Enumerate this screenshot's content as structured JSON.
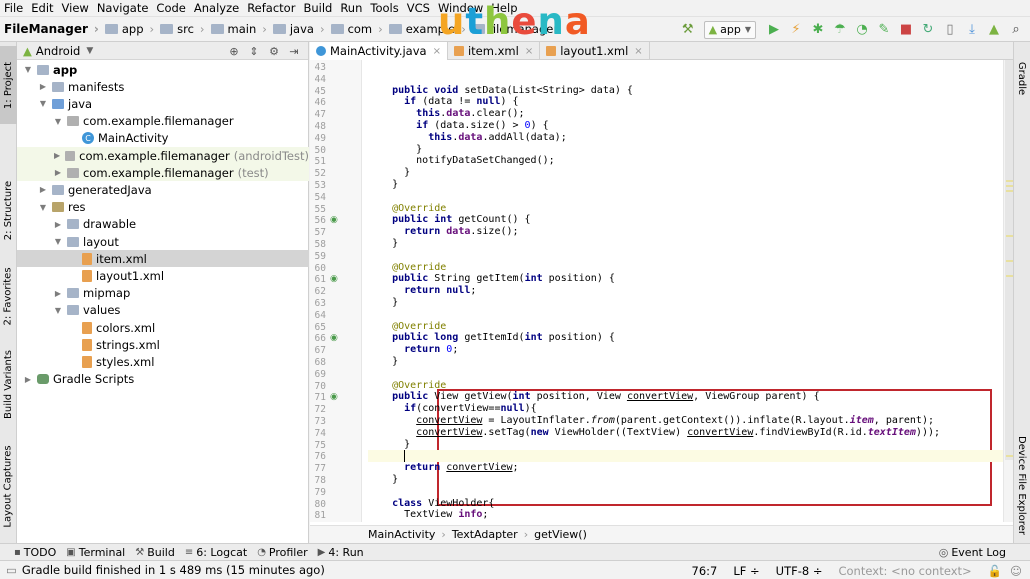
{
  "menu": [
    "File",
    "Edit",
    "View",
    "Navigate",
    "Code",
    "Analyze",
    "Refactor",
    "Build",
    "Run",
    "Tools",
    "VCS",
    "Window",
    "Help"
  ],
  "breadcrumbs": [
    "FileManager",
    "app",
    "src",
    "main",
    "java",
    "com",
    "example",
    "filemanager"
  ],
  "run_config": "app",
  "logo": {
    "letters": [
      "u",
      "t",
      "h",
      "e",
      "n",
      "a"
    ],
    "colors": [
      "#f4a523",
      "#1b9fd6",
      "#8dc63f",
      "#e94b3c",
      "#29b9c5",
      "#f15a24"
    ]
  },
  "left_tool_windows": [
    "1: Project",
    "2: Structure",
    "2: Favorites",
    "Build Variants",
    "Layout Captures"
  ],
  "right_tool_windows": [
    "Gradle",
    "Device File Explorer"
  ],
  "project_panel": {
    "view_label": "Android",
    "tree": [
      {
        "label": "app",
        "depth": 0,
        "arrow": "▼",
        "icon": "dir",
        "bold": true
      },
      {
        "label": "manifests",
        "depth": 1,
        "arrow": "▶",
        "icon": "dir"
      },
      {
        "label": "java",
        "depth": 1,
        "arrow": "▼",
        "icon": "dir-src"
      },
      {
        "label": "com.example.filemanager",
        "depth": 2,
        "arrow": "▼",
        "icon": "pkg"
      },
      {
        "label": "MainActivity",
        "depth": 3,
        "arrow": "",
        "icon": "cls"
      },
      {
        "label": "com.example.filemanager",
        "depth": 2,
        "arrow": "▶",
        "icon": "pkg",
        "suffix": "(androidTest)",
        "test": true
      },
      {
        "label": "com.example.filemanager",
        "depth": 2,
        "arrow": "▶",
        "icon": "pkg",
        "suffix": "(test)",
        "test": true
      },
      {
        "label": "generatedJava",
        "depth": 1,
        "arrow": "▶",
        "icon": "dir"
      },
      {
        "label": "res",
        "depth": 1,
        "arrow": "▼",
        "icon": "dir-res"
      },
      {
        "label": "drawable",
        "depth": 2,
        "arrow": "▶",
        "icon": "dir"
      },
      {
        "label": "layout",
        "depth": 2,
        "arrow": "▼",
        "icon": "dir"
      },
      {
        "label": "item.xml",
        "depth": 3,
        "arrow": "",
        "icon": "xml",
        "selected": true
      },
      {
        "label": "layout1.xml",
        "depth": 3,
        "arrow": "",
        "icon": "xml"
      },
      {
        "label": "mipmap",
        "depth": 2,
        "arrow": "▶",
        "icon": "dir"
      },
      {
        "label": "values",
        "depth": 2,
        "arrow": "▼",
        "icon": "dir"
      },
      {
        "label": "colors.xml",
        "depth": 3,
        "arrow": "",
        "icon": "xml"
      },
      {
        "label": "strings.xml",
        "depth": 3,
        "arrow": "",
        "icon": "xml"
      },
      {
        "label": "styles.xml",
        "depth": 3,
        "arrow": "",
        "icon": "xml"
      },
      {
        "label": "Gradle Scripts",
        "depth": 0,
        "arrow": "▶",
        "icon": "gradle"
      }
    ]
  },
  "editor": {
    "tabs": [
      {
        "label": "MainActivity.java",
        "icon": "c",
        "active": true
      },
      {
        "label": "item.xml",
        "icon": "x"
      },
      {
        "label": "layout1.xml",
        "icon": "x"
      }
    ],
    "first_line": 43,
    "current_line": 76,
    "lines": [
      [],
      [],
      [
        [
          "    ",
          ""
        ],
        [
          "public void ",
          "kw"
        ],
        [
          "setData(List<String> data) {",
          ""
        ]
      ],
      [
        [
          "      ",
          ""
        ],
        [
          "if ",
          "kw"
        ],
        [
          "(data != ",
          ""
        ],
        [
          "null",
          "kw"
        ],
        [
          ") {",
          ""
        ]
      ],
      [
        [
          "        ",
          ""
        ],
        [
          "this",
          "kw"
        ],
        [
          ".",
          ""
        ],
        [
          "data",
          "fd"
        ],
        [
          ".clear();",
          ""
        ]
      ],
      [
        [
          "        ",
          ""
        ],
        [
          "if ",
          "kw"
        ],
        [
          "(data.size() > ",
          ""
        ],
        [
          "0",
          "num"
        ],
        [
          ") {",
          ""
        ]
      ],
      [
        [
          "          ",
          ""
        ],
        [
          "this",
          "kw"
        ],
        [
          ".",
          ""
        ],
        [
          "data",
          "fd"
        ],
        [
          ".addAll(data);",
          ""
        ]
      ],
      [
        [
          "        }",
          ""
        ]
      ],
      [
        [
          "        notifyDataSetChanged();",
          ""
        ]
      ],
      [
        [
          "      }",
          ""
        ]
      ],
      [
        [
          "    }",
          ""
        ]
      ],
      [],
      [
        [
          "    ",
          ""
        ],
        [
          "@Override",
          "an"
        ]
      ],
      [
        [
          "    ",
          ""
        ],
        [
          "public int ",
          "kw"
        ],
        [
          "getCount() {",
          ""
        ]
      ],
      [
        [
          "      ",
          ""
        ],
        [
          "return ",
          "kw"
        ],
        [
          "data",
          "fd"
        ],
        [
          ".size();",
          ""
        ]
      ],
      [
        [
          "    }",
          ""
        ]
      ],
      [],
      [
        [
          "    ",
          ""
        ],
        [
          "@Override",
          "an"
        ]
      ],
      [
        [
          "    ",
          ""
        ],
        [
          "public ",
          "kw"
        ],
        [
          "String getItem(",
          ""
        ],
        [
          "int ",
          "kw"
        ],
        [
          "position) {",
          ""
        ]
      ],
      [
        [
          "      ",
          ""
        ],
        [
          "return null",
          "kw"
        ],
        [
          ";",
          ""
        ]
      ],
      [
        [
          "    }",
          ""
        ]
      ],
      [],
      [
        [
          "    ",
          ""
        ],
        [
          "@Override",
          "an"
        ]
      ],
      [
        [
          "    ",
          ""
        ],
        [
          "public long ",
          "kw"
        ],
        [
          "getItemId(",
          ""
        ],
        [
          "int ",
          "kw"
        ],
        [
          "position) {",
          ""
        ]
      ],
      [
        [
          "      ",
          ""
        ],
        [
          "return ",
          "kw"
        ],
        [
          "0",
          "num"
        ],
        [
          ";",
          ""
        ]
      ],
      [
        [
          "    }",
          ""
        ]
      ],
      [],
      [
        [
          "    ",
          ""
        ],
        [
          "@Override",
          "an"
        ]
      ],
      [
        [
          "    ",
          ""
        ],
        [
          "public ",
          "kw"
        ],
        [
          "View getView(",
          ""
        ],
        [
          "int ",
          "kw"
        ],
        [
          "position, View ",
          ""
        ],
        [
          "convertView",
          "ul"
        ],
        [
          ", ViewGroup parent) {",
          ""
        ]
      ],
      [
        [
          "      ",
          ""
        ],
        [
          "if",
          "kw"
        ],
        [
          "(convertView==",
          ""
        ],
        [
          "null",
          "kw"
        ],
        [
          "){",
          ""
        ]
      ],
      [
        [
          "        ",
          ""
        ],
        [
          "convertView",
          "ul"
        ],
        [
          " = LayoutInflater.",
          ""
        ],
        [
          "from",
          "it"
        ],
        [
          "(parent.getContext()).inflate(R.layout.",
          ""
        ],
        [
          "item",
          "fit"
        ],
        [
          ", parent);",
          ""
        ]
      ],
      [
        [
          "        ",
          ""
        ],
        [
          "convertView",
          "ul"
        ],
        [
          ".setTag(",
          ""
        ],
        [
          "new ",
          "kw"
        ],
        [
          "ViewHolder((TextView) ",
          ""
        ],
        [
          "convertView",
          "ul"
        ],
        [
          ".findViewById(R.id.",
          ""
        ],
        [
          "textItem",
          "fit"
        ],
        [
          ")));",
          ""
        ]
      ],
      [
        [
          "      }",
          ""
        ]
      ],
      [
        [
          "      ",
          ""
        ]
      ],
      [
        [
          "      ",
          ""
        ],
        [
          "return ",
          "kw"
        ],
        [
          "convertView",
          "ul"
        ],
        [
          ";",
          ""
        ]
      ],
      [
        [
          "    }",
          ""
        ]
      ],
      [],
      [
        [
          "    ",
          ""
        ],
        [
          "class ",
          "kw"
        ],
        [
          "ViewHolder{",
          ""
        ]
      ],
      [
        [
          "      TextView ",
          ""
        ],
        [
          "info",
          "fd"
        ],
        [
          ";",
          ""
        ]
      ]
    ],
    "override_lines": [
      56,
      61,
      66,
      71
    ],
    "crumbs": [
      "MainActivity",
      "TextAdapter",
      "getView()"
    ]
  },
  "bottom_tools": [
    {
      "icon": "▪",
      "label": "TODO"
    },
    {
      "icon": "▣",
      "label": "Terminal"
    },
    {
      "icon": "⚒",
      "label": "Build"
    },
    {
      "icon": "≡",
      "label": "6: Logcat"
    },
    {
      "icon": "◔",
      "label": "Profiler"
    },
    {
      "icon": "▶",
      "label": "4: Run"
    }
  ],
  "event_log": "Event Log",
  "status": {
    "message": "Gradle build finished in 1 s 489 ms (15 minutes ago)",
    "position": "76:7",
    "line_sep": "LF ÷",
    "encoding": "UTF-8 ÷",
    "context": "Context: <no context>"
  }
}
